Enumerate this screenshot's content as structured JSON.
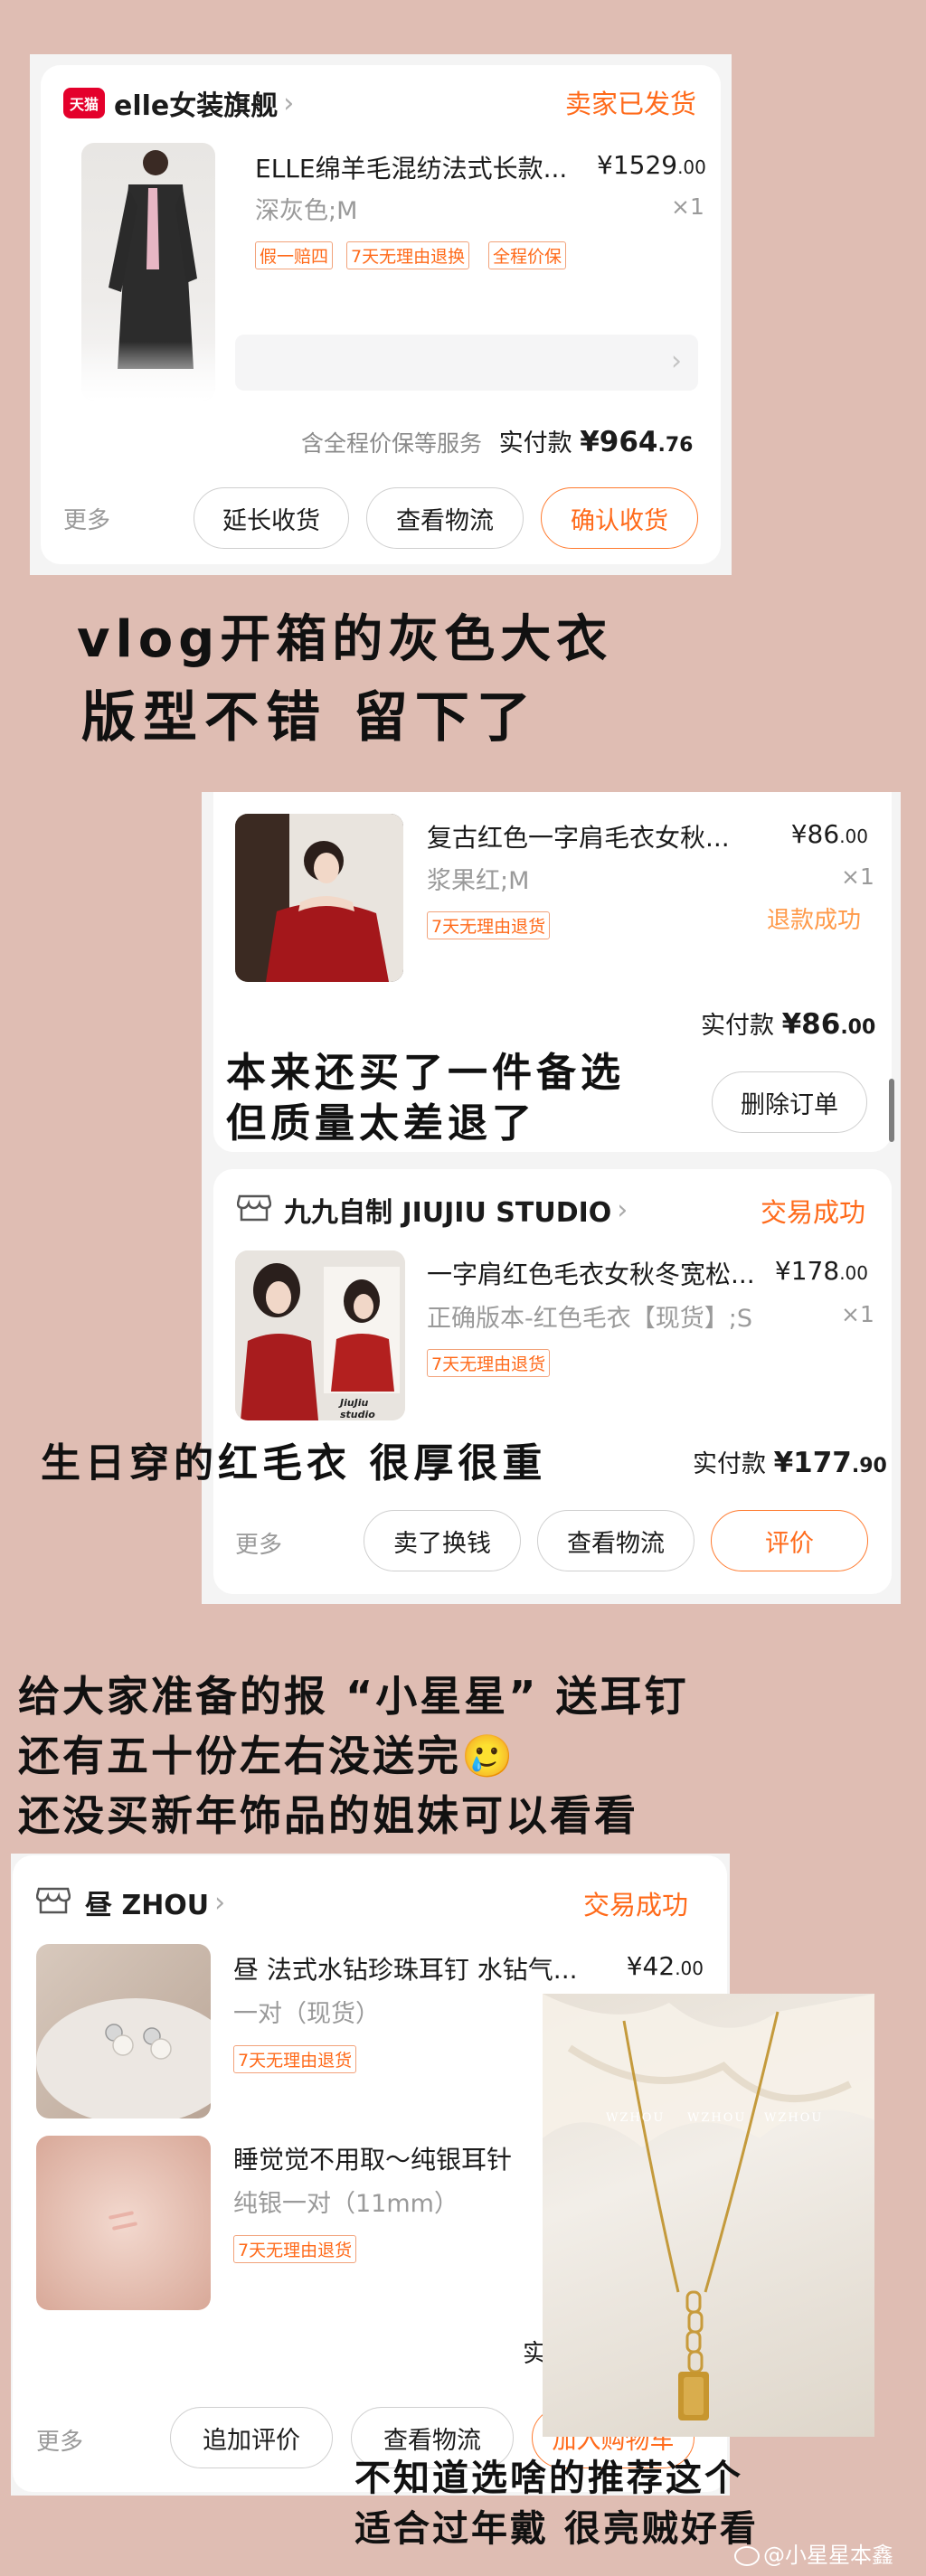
{
  "order1": {
    "platform_badge": "天猫",
    "shop": "elle女装旗舰",
    "status": "卖家已发货",
    "title": "ELLE绵羊毛混纺法式长款...",
    "price_main": "¥1529",
    "price_dec": ".00",
    "spec": "深灰色;M",
    "qty": "×1",
    "tags": [
      "假一赔四",
      "7天无理由退换",
      "全程价保"
    ],
    "guarantee": "含全程价保等服务",
    "paid_label": "实付款",
    "paid_main": "¥964",
    "paid_dec": ".76",
    "more": "更多",
    "btn_extend": "延长收货",
    "btn_logistics": "查看物流",
    "btn_confirm": "确认收货"
  },
  "note1": {
    "line1": "vlog开箱的灰色大衣",
    "line2": "版型不错 留下了"
  },
  "order2": {
    "title": "复古红色一字肩毛衣女秋...",
    "price_main": "¥86",
    "price_dec": ".00",
    "spec": "浆果红;M",
    "qty": "×1",
    "tag": "7天无理由退货",
    "refund": "退款成功",
    "paid_label": "实付款",
    "paid_main": "¥86",
    "paid_dec": ".00",
    "btn_delete": "删除订单"
  },
  "note2": {
    "line1": "本来还买了一件备选",
    "line2": "但质量太差退了"
  },
  "order3": {
    "shop": "九九自制 JIUJIU STUDIO",
    "status": "交易成功",
    "title": "一字肩红色毛衣女秋冬宽松...",
    "price_main": "¥178",
    "price_dec": ".00",
    "spec": "正确版本-红色毛衣【现货】;S",
    "qty": "×1",
    "tag": "7天无理由退货",
    "img_caption": "JiuJiu studio",
    "paid_label": "实付款",
    "paid_main": "¥177",
    "paid_dec": ".90",
    "more": "更多",
    "btn_sell": "卖了换钱",
    "btn_logistics": "查看物流",
    "btn_review": "评价"
  },
  "note3": {
    "line1": "生日穿的红毛衣 很厚很重"
  },
  "note4": {
    "line1": "给大家准备的报 “小星星” 送耳钉",
    "line2": "还有五十份左右没送完🥲",
    "line3": "还没买新年饰品的姐妹可以看看"
  },
  "order4": {
    "shop": "昼 ZHOU",
    "status": "交易成功",
    "item1_title": "昼 法式水钻珍珠耳钉 水钻气...",
    "item1_price_main": "¥42",
    "item1_price_dec": ".00",
    "item1_spec": "一对（现货）",
    "item1_tag": "7天无理由退货",
    "item2_title": "睡觉觉不用取～纯银耳针",
    "item2_spec": "纯银一对（11mm）",
    "item2_tag": "7天无理由退货",
    "paid_label_partial": "实",
    "more": "更多",
    "btn_review": "追加评价",
    "btn_logistics": "查看物流",
    "btn_cart": "加入购物车"
  },
  "photo_text": "WZHOU",
  "note5": {
    "line1": "不知道选啥的推荐这个",
    "line2": "适合过年戴 很亮贼好看"
  },
  "watermark": "@小星星本鑫",
  "colors": {
    "background": "#dfbdb3",
    "accent": "#ff6a1a",
    "tmall_red": "#e4002b"
  }
}
